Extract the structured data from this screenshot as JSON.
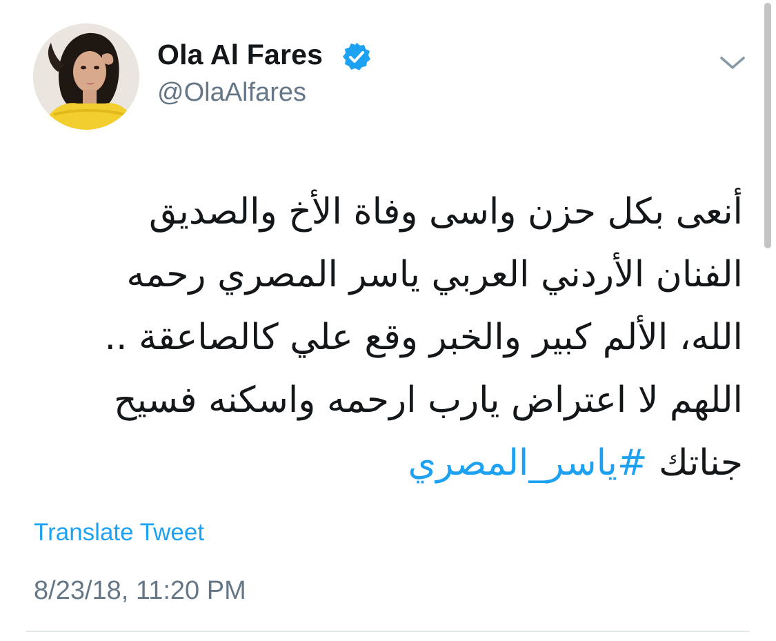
{
  "author": {
    "name": "Ola Al Fares",
    "handle": "@OlaAlfares",
    "verified": true
  },
  "tweet": {
    "lines": [
      "أنعى بكل حزن واسى وفاة الأخ  والصديق",
      "الفنان الأردني  العربي ياسر المصري رحمه",
      "الله، الألم كبير  والخبر وقع علي كالصاعقة ..",
      "اللهم لا اعتراض يارب ارحمه واسكنه فسيح"
    ],
    "last_line_text": "جناتك ",
    "hashtag": "#ياسر_المصري"
  },
  "translate_label": "Translate Tweet",
  "timestamp": "8/23/18, 11:20 PM",
  "icons": {
    "verified": "verified-badge-icon",
    "menu": "chevron-down-icon"
  },
  "colors": {
    "link": "#1da1f2",
    "text": "#14171a",
    "secondary": "#657786",
    "avatar_top": "#e8e2dc",
    "avatar_dress": "#f2cf2e"
  }
}
